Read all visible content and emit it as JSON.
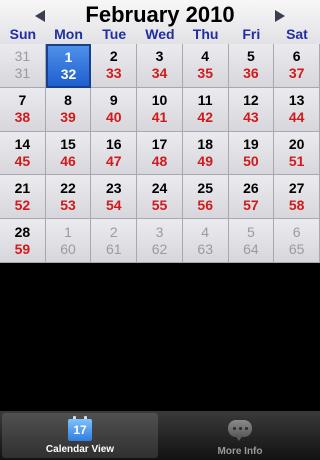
{
  "header": {
    "title": "February 2010",
    "weekdays": [
      "Sun",
      "Mon",
      "Tue",
      "Wed",
      "Thu",
      "Fri",
      "Sat"
    ]
  },
  "calendar": {
    "weeks": [
      [
        {
          "day": "31",
          "num": "31",
          "other": true
        },
        {
          "day": "1",
          "num": "32",
          "selected": true
        },
        {
          "day": "2",
          "num": "33"
        },
        {
          "day": "3",
          "num": "34"
        },
        {
          "day": "4",
          "num": "35"
        },
        {
          "day": "5",
          "num": "36"
        },
        {
          "day": "6",
          "num": "37"
        }
      ],
      [
        {
          "day": "7",
          "num": "38"
        },
        {
          "day": "8",
          "num": "39"
        },
        {
          "day": "9",
          "num": "40"
        },
        {
          "day": "10",
          "num": "41"
        },
        {
          "day": "11",
          "num": "42"
        },
        {
          "day": "12",
          "num": "43"
        },
        {
          "day": "13",
          "num": "44"
        }
      ],
      [
        {
          "day": "14",
          "num": "45"
        },
        {
          "day": "15",
          "num": "46"
        },
        {
          "day": "16",
          "num": "47"
        },
        {
          "day": "17",
          "num": "48"
        },
        {
          "day": "18",
          "num": "49"
        },
        {
          "day": "19",
          "num": "50"
        },
        {
          "day": "20",
          "num": "51"
        }
      ],
      [
        {
          "day": "21",
          "num": "52"
        },
        {
          "day": "22",
          "num": "53"
        },
        {
          "day": "23",
          "num": "54"
        },
        {
          "day": "24",
          "num": "55"
        },
        {
          "day": "25",
          "num": "56"
        },
        {
          "day": "26",
          "num": "57"
        },
        {
          "day": "27",
          "num": "58"
        }
      ],
      [
        {
          "day": "28",
          "num": "59"
        },
        {
          "day": "1",
          "num": "60",
          "other": true
        },
        {
          "day": "2",
          "num": "61",
          "other": true
        },
        {
          "day": "3",
          "num": "62",
          "other": true
        },
        {
          "day": "4",
          "num": "63",
          "other": true
        },
        {
          "day": "5",
          "num": "64",
          "other": true
        },
        {
          "day": "6",
          "num": "65",
          "other": true
        }
      ]
    ]
  },
  "tabbar": {
    "tabs": [
      {
        "label": "Calendar View",
        "icon": "calendar-icon",
        "icon_text": "17",
        "active": true
      },
      {
        "label": "More Info",
        "icon": "speech-bubble-icon",
        "active": false
      }
    ]
  },
  "colors": {
    "weekday": "#1f2fa3",
    "day_number": "#d01b1b",
    "selected": "#2f6fdc",
    "muted": "#9a9aa0"
  }
}
